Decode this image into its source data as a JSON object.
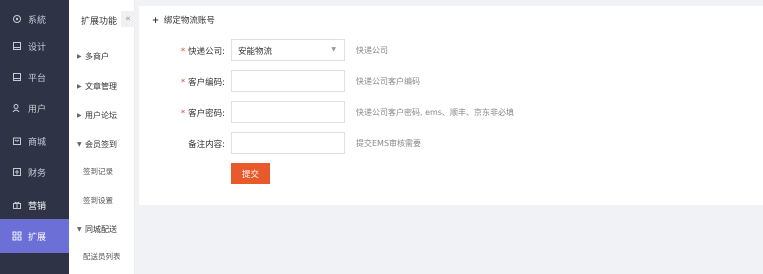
{
  "nav": {
    "items": [
      {
        "label": "系統",
        "icon": "gear-icon"
      },
      {
        "label": "设计",
        "icon": "design-icon"
      },
      {
        "label": "平台",
        "icon": "platform-icon"
      },
      {
        "label": "用户",
        "icon": "user-icon"
      },
      {
        "label": "商城",
        "icon": "mall-icon"
      },
      {
        "label": "财务",
        "icon": "finance-icon"
      },
      {
        "label": "营销",
        "icon": "marketing-icon"
      },
      {
        "label": "扩展",
        "icon": "extend-icon"
      }
    ],
    "active_index": 7,
    "active_color": "#6b6fd6",
    "bg_color": "#2f3346"
  },
  "sidebar": {
    "title": "扩展功能",
    "collapse_glyph": "«",
    "groups": [
      {
        "label": "多商户",
        "expanded": false
      },
      {
        "label": "文章管理",
        "expanded": false
      },
      {
        "label": "用户论坛",
        "expanded": false
      },
      {
        "label": "会员签到",
        "expanded": true,
        "children": [
          "签到记录",
          "签到设置"
        ]
      },
      {
        "label": "同城配送",
        "expanded": true,
        "children": [
          "配送员列表"
        ]
      }
    ]
  },
  "form": {
    "heading_plus": "+",
    "heading": "绑定物流账号",
    "fields": [
      {
        "label": "快递公司:",
        "required": true,
        "type": "select",
        "value": "安能物流",
        "hint": "快递公司"
      },
      {
        "label": "客户编码:",
        "required": true,
        "type": "input",
        "value": "",
        "hint": "快递公司客户编码"
      },
      {
        "label": "客户密码:",
        "required": true,
        "type": "input",
        "value": "",
        "hint": "快递公司客户密码, ems、顺丰、京东非必填"
      },
      {
        "label": "备注内容:",
        "required": false,
        "type": "input",
        "value": "",
        "hint": "提交EMS审核需要"
      }
    ],
    "submit_label": "提交",
    "submit_color": "#e85a2b"
  }
}
